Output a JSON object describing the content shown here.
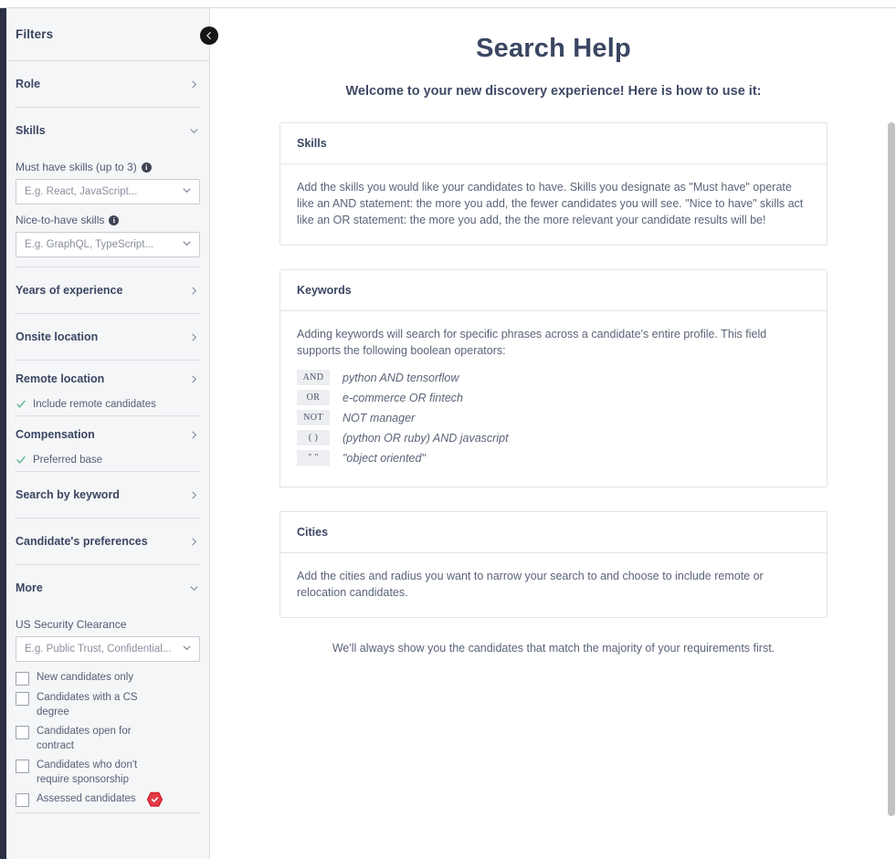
{
  "sidebar": {
    "header_title": "Filters",
    "collapse_icon": "chevron-left-icon",
    "sections": [
      {
        "label": "Role",
        "chevron": "chevron-right-icon"
      },
      {
        "label": "Skills",
        "chevron": "chevron-down-icon"
      },
      {
        "label": "Years of experience",
        "chevron": "chevron-right-icon"
      },
      {
        "label": "Onsite location",
        "chevron": "chevron-right-icon"
      },
      {
        "label": "Remote location",
        "chevron": "chevron-right-icon"
      },
      {
        "label": "Compensation",
        "chevron": "chevron-right-icon"
      },
      {
        "label": "Search by keyword",
        "chevron": "chevron-right-icon"
      },
      {
        "label": "Candidate's preferences",
        "chevron": "chevron-right-icon"
      },
      {
        "label": "More",
        "chevron": "chevron-down-icon"
      }
    ],
    "skills": {
      "must_have_label": "Must have skills (up to 3)",
      "must_have_placeholder": "E.g. React, JavaScript...",
      "nice_to_have_label": "Nice-to-have skills",
      "nice_to_have_placeholder": "E.g. GraphQL, TypeScript..."
    },
    "remote_location": {
      "check_label": "Include remote candidates"
    },
    "compensation": {
      "check_label": "Preferred base"
    },
    "more": {
      "clearance_label": "US Security Clearance",
      "clearance_placeholder": "E.g. Public Trust, Confidential...",
      "checkboxes": [
        {
          "label": "New candidates only",
          "checked": false,
          "badge": null
        },
        {
          "label": "Candidates with a CS degree",
          "checked": false,
          "badge": null
        },
        {
          "label": "Candidates open for contract",
          "checked": false,
          "badge": null
        },
        {
          "label": "Candidates who don't require sponsorship",
          "checked": false,
          "badge": null
        },
        {
          "label": "Assessed candidates",
          "checked": false,
          "badge": "assessed-badge-icon"
        }
      ]
    }
  },
  "main": {
    "title": "Search Help",
    "subtitle": "Welcome to your new discovery experience! Here is how to use it:",
    "cards": [
      {
        "heading": "Skills",
        "body": "Add the skills you would like your candidates to have. Skills you designate as \"Must have\" operate like an AND statement: the more you add, the fewer candidates you will see. \"Nice to have\" skills act like an OR statement: the more you add, the the more relevant your candidate results will be!"
      },
      {
        "heading": "Keywords",
        "body": "Adding keywords will search for specific phrases across a candidate's entire profile. This field supports the following boolean operators:",
        "operators": [
          {
            "tag": "AND",
            "example": "python AND tensorflow"
          },
          {
            "tag": "OR",
            "example": "e-commerce OR fintech"
          },
          {
            "tag": "NOT",
            "example": "NOT manager"
          },
          {
            "tag": "(  )",
            "example": "(python OR ruby) AND javascript"
          },
          {
            "tag": "\"  \"",
            "example": "\"object oriented\""
          }
        ]
      },
      {
        "heading": "Cities",
        "body": "Add the cities and radius you want to narrow your search to and choose to include remote or relocation candidates."
      }
    ],
    "footnote": "We'll always show you the candidates that match the majority of your requirements first."
  },
  "colors": {
    "sidebar_bg": "#f5f6f7",
    "nav_rail": "#2b3045",
    "heading": "#3b4663",
    "body_text": "#5a6478",
    "check_green": "#4cb07d",
    "badge_red": "#d0232f",
    "collapse_btn": "#17171a"
  }
}
